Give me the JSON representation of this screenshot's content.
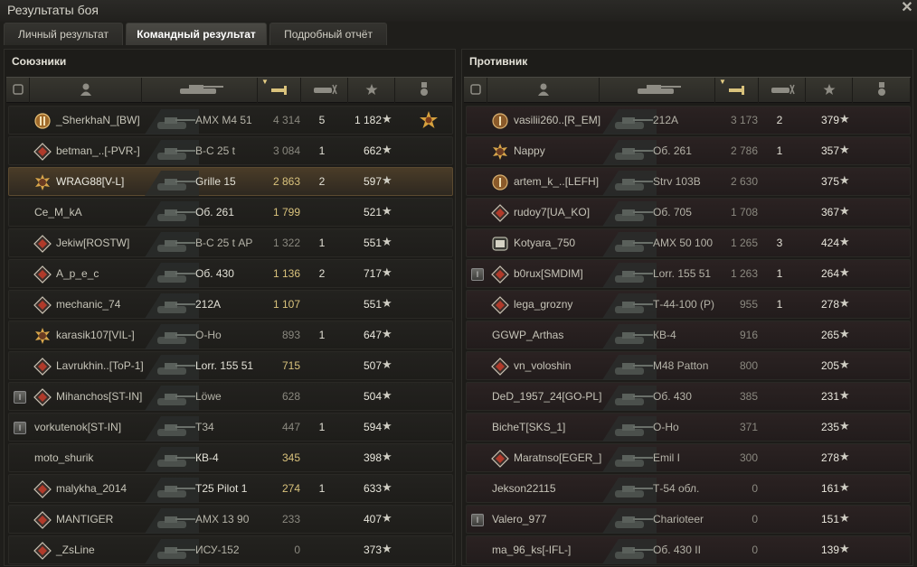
{
  "window": {
    "title": "Результаты боя",
    "close": "✕"
  },
  "tabs": [
    "Личный результат",
    "Командный результат",
    "Подробный отчёт"
  ],
  "allies": {
    "title": "Союзники",
    "rows": [
      {
        "name": "_SherkhaN_[BW]",
        "vehicle": "AMX M4 51",
        "damage": "4 314",
        "kills": "5",
        "xp": "1 182",
        "platoon": "",
        "badge": "rank2",
        "style": "dark",
        "medal": true,
        "dmg_gold": false
      },
      {
        "name": "betman_..[-PVR-]",
        "vehicle": "В-С 25 t",
        "damage": "3 084",
        "kills": "1",
        "xp": "662",
        "platoon": "",
        "badge": "red",
        "style": "dark",
        "medal": false,
        "dmg_gold": false
      },
      {
        "name": "WRAG88[V-L]",
        "vehicle": "Grille 15",
        "damage": "2 863",
        "kills": "2",
        "xp": "597",
        "platoon": "",
        "badge": "gold",
        "style": "me",
        "medal": false,
        "dmg_gold": true
      },
      {
        "name": "Ce_M_kA",
        "vehicle": "Об. 261",
        "damage": "1 799",
        "kills": "",
        "xp": "521",
        "platoon": "",
        "badge": "",
        "style": "dark",
        "medal": false,
        "dmg_gold": true
      },
      {
        "name": "Jekiw[ROSTW]",
        "vehicle": "В-С 25 t АР",
        "damage": "1 322",
        "kills": "1",
        "xp": "551",
        "platoon": "",
        "badge": "red",
        "style": "dark",
        "medal": false,
        "dmg_gold": false
      },
      {
        "name": "A_p_e_c",
        "vehicle": "Об. 430",
        "damage": "1 136",
        "kills": "2",
        "xp": "717",
        "platoon": "",
        "badge": "red",
        "style": "dark",
        "medal": false,
        "dmg_gold": true
      },
      {
        "name": "mechanic_74",
        "vehicle": "212A",
        "damage": "1 107",
        "kills": "",
        "xp": "551",
        "platoon": "",
        "badge": "red",
        "style": "dark",
        "medal": false,
        "dmg_gold": true
      },
      {
        "name": "karasik107[VIL-]",
        "vehicle": "О-Но",
        "damage": "893",
        "kills": "1",
        "xp": "647",
        "platoon": "",
        "badge": "gold",
        "style": "dark",
        "medal": false,
        "dmg_gold": false
      },
      {
        "name": "Lavrukhin..[ToP-1]",
        "vehicle": "Lorr. 155 51",
        "damage": "715",
        "kills": "",
        "xp": "507",
        "platoon": "",
        "badge": "red",
        "style": "dark",
        "medal": false,
        "dmg_gold": true
      },
      {
        "name": "Mihanchos[ST-IN]",
        "vehicle": "Löwe",
        "damage": "628",
        "kills": "",
        "xp": "504",
        "platoon": "I",
        "badge": "red",
        "style": "dark",
        "medal": false,
        "dmg_gold": false
      },
      {
        "name": "vorkutenok[ST-IN]",
        "vehicle": "T34",
        "damage": "447",
        "kills": "1",
        "xp": "594",
        "platoon": "I",
        "badge": "",
        "style": "dark",
        "medal": false,
        "dmg_gold": false
      },
      {
        "name": "moto_shurik",
        "vehicle": "КВ-4",
        "damage": "345",
        "kills": "",
        "xp": "398",
        "platoon": "",
        "badge": "",
        "style": "dark",
        "medal": false,
        "dmg_gold": true
      },
      {
        "name": "malykha_2014",
        "vehicle": "T25 Pilot 1",
        "damage": "274",
        "kills": "1",
        "xp": "633",
        "platoon": "",
        "badge": "red",
        "style": "dark",
        "medal": false,
        "dmg_gold": true
      },
      {
        "name": "MANTIGER",
        "vehicle": "AMX 13 90",
        "damage": "233",
        "kills": "",
        "xp": "407",
        "platoon": "",
        "badge": "red",
        "style": "dark",
        "medal": false,
        "dmg_gold": false
      },
      {
        "name": "_ZsLine",
        "vehicle": "ИСУ-152",
        "damage": "0",
        "kills": "",
        "xp": "373",
        "platoon": "",
        "badge": "red",
        "style": "dark",
        "medal": false,
        "dmg_gold": false
      }
    ]
  },
  "enemies": {
    "title": "Противник",
    "rows": [
      {
        "name": "vasilii260..[R_EM]",
        "vehicle": "212A",
        "damage": "3 173",
        "kills": "2",
        "xp": "379",
        "platoon": "",
        "badge": "rank1",
        "style": "red",
        "medal": false,
        "dmg_gold": false
      },
      {
        "name": "Nappy",
        "vehicle": "Об. 261",
        "damage": "2 786",
        "kills": "1",
        "xp": "357",
        "platoon": "",
        "badge": "gold",
        "style": "red",
        "medal": false,
        "dmg_gold": false
      },
      {
        "name": "artem_k_..[LEFH]",
        "vehicle": "Strv 103B",
        "damage": "2 630",
        "kills": "",
        "xp": "375",
        "platoon": "",
        "badge": "rank1",
        "style": "red",
        "medal": false,
        "dmg_gold": false
      },
      {
        "name": "rudoy7[UA_KO]",
        "vehicle": "Об. 705",
        "damage": "1 708",
        "kills": "",
        "xp": "367",
        "platoon": "",
        "badge": "red",
        "style": "red",
        "medal": false,
        "dmg_gold": false
      },
      {
        "name": "Kotyara_750",
        "vehicle": "AMX 50 100",
        "damage": "1 265",
        "kills": "3",
        "xp": "424",
        "platoon": "",
        "badge": "rank8",
        "style": "red",
        "medal": false,
        "dmg_gold": false
      },
      {
        "name": "b0rux[SMDIM]",
        "vehicle": "Lorr. 155 51",
        "damage": "1 263",
        "kills": "1",
        "xp": "264",
        "platoon": "I",
        "badge": "red",
        "style": "red",
        "medal": false,
        "dmg_gold": false
      },
      {
        "name": "lega_grozny",
        "vehicle": "Т-44-100 (Р)",
        "damage": "955",
        "kills": "1",
        "xp": "278",
        "platoon": "",
        "badge": "red",
        "style": "red",
        "medal": false,
        "dmg_gold": false
      },
      {
        "name": "GGWP_Arthas",
        "vehicle": "КВ-4",
        "damage": "916",
        "kills": "",
        "xp": "265",
        "platoon": "",
        "badge": "",
        "style": "red",
        "medal": false,
        "dmg_gold": false
      },
      {
        "name": "vn_voloshin",
        "vehicle": "M48 Patton",
        "damage": "800",
        "kills": "",
        "xp": "205",
        "platoon": "",
        "badge": "red",
        "style": "red",
        "medal": false,
        "dmg_gold": false
      },
      {
        "name": "DeD_1957_24[GO-PL]",
        "vehicle": "Об. 430",
        "damage": "385",
        "kills": "",
        "xp": "231",
        "platoon": "",
        "badge": "",
        "style": "red",
        "medal": false,
        "dmg_gold": false
      },
      {
        "name": "BicheT[SKS_1]",
        "vehicle": "О-Но",
        "damage": "371",
        "kills": "",
        "xp": "235",
        "platoon": "",
        "badge": "",
        "style": "red",
        "medal": false,
        "dmg_gold": false
      },
      {
        "name": "Maratnso[EGER_]",
        "vehicle": "Emil I",
        "damage": "300",
        "kills": "",
        "xp": "278",
        "platoon": "",
        "badge": "red",
        "style": "red",
        "medal": false,
        "dmg_gold": false
      },
      {
        "name": "Jekson22115",
        "vehicle": "Т-54 обл.",
        "damage": "0",
        "kills": "",
        "xp": "161",
        "platoon": "",
        "badge": "",
        "style": "red",
        "medal": false,
        "dmg_gold": false
      },
      {
        "name": "Valero_977",
        "vehicle": "Charioteer",
        "damage": "0",
        "kills": "",
        "xp": "151",
        "platoon": "I",
        "badge": "",
        "style": "red",
        "medal": false,
        "dmg_gold": false
      },
      {
        "name": "ma_96_ks[-IFL-]",
        "vehicle": "Об. 430 II",
        "damage": "0",
        "kills": "",
        "xp": "139",
        "platoon": "",
        "badge": "",
        "style": "red",
        "medal": false,
        "dmg_gold": false
      }
    ]
  },
  "colors": {
    "gold": "#d9c27c",
    "me_row": "#4a3c28"
  }
}
